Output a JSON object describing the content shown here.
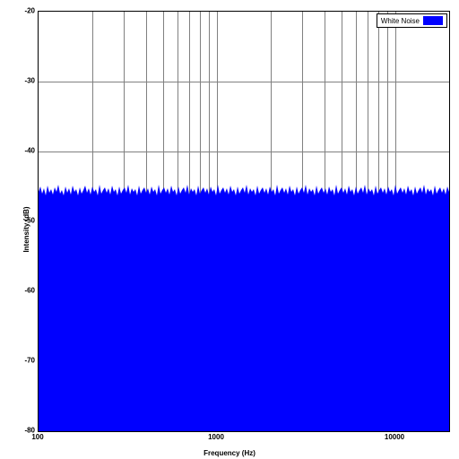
{
  "chart_data": {
    "type": "area",
    "title": "",
    "xlabel": "Frequency (Hz)",
    "ylabel": "Intensity (dB)",
    "x_scale": "log",
    "xlim": [
      100,
      20000
    ],
    "ylim": [
      -80,
      -20
    ],
    "x_ticks": [
      100,
      1000,
      10000
    ],
    "y_ticks": [
      -20,
      -30,
      -40,
      -50,
      -60,
      -70,
      -80
    ],
    "series": [
      {
        "name": "White Noise",
        "color": "#0000ff",
        "description": "Flat spectral density noise floor across frequency range",
        "mean_level_db": -47,
        "peak_variation_db": 3
      }
    ],
    "legend_position": "top-right",
    "grid": true
  },
  "legend": {
    "label": "White Noise"
  },
  "axes": {
    "x": {
      "label": "Frequency (Hz)",
      "ticks": [
        "100",
        "1000",
        "10000"
      ]
    },
    "y": {
      "label": "Intensity (dB)",
      "ticks": [
        "-20",
        "-30",
        "-40",
        "-50",
        "-60",
        "-70",
        "-80"
      ]
    }
  }
}
